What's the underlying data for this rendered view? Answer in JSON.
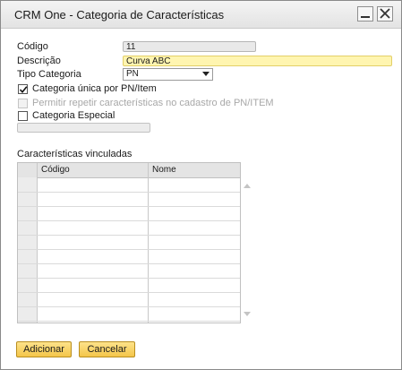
{
  "window": {
    "title": "CRM One - Categoria de Características"
  },
  "form": {
    "codigo_label": "Código",
    "codigo_value": "11",
    "descricao_label": "Descrição",
    "descricao_value": "Curva ABC",
    "tipo_label": "Tipo Categoria",
    "tipo_value": "PN",
    "check_unica_label": "Categoria única por PN/Item",
    "check_unica_checked": true,
    "check_repetir_label": "Permitir repetir características no cadastro de PN/ITEM",
    "check_repetir_checked": false,
    "check_especial_label": "Categoria Especial",
    "check_especial_checked": false
  },
  "grid": {
    "title": "Características vinculadas",
    "columns": [
      "Código",
      "Nome"
    ],
    "rows": [
      [
        "",
        ""
      ],
      [
        "",
        ""
      ],
      [
        "",
        ""
      ],
      [
        "",
        ""
      ],
      [
        "",
        ""
      ],
      [
        "",
        ""
      ],
      [
        "",
        ""
      ],
      [
        "",
        ""
      ],
      [
        "",
        ""
      ],
      [
        "",
        ""
      ]
    ]
  },
  "buttons": {
    "add": "Adicionar",
    "cancel": "Cancelar"
  },
  "colors": {
    "button_fill": "#f4c54a",
    "highlight_field": "#fff5b0"
  }
}
